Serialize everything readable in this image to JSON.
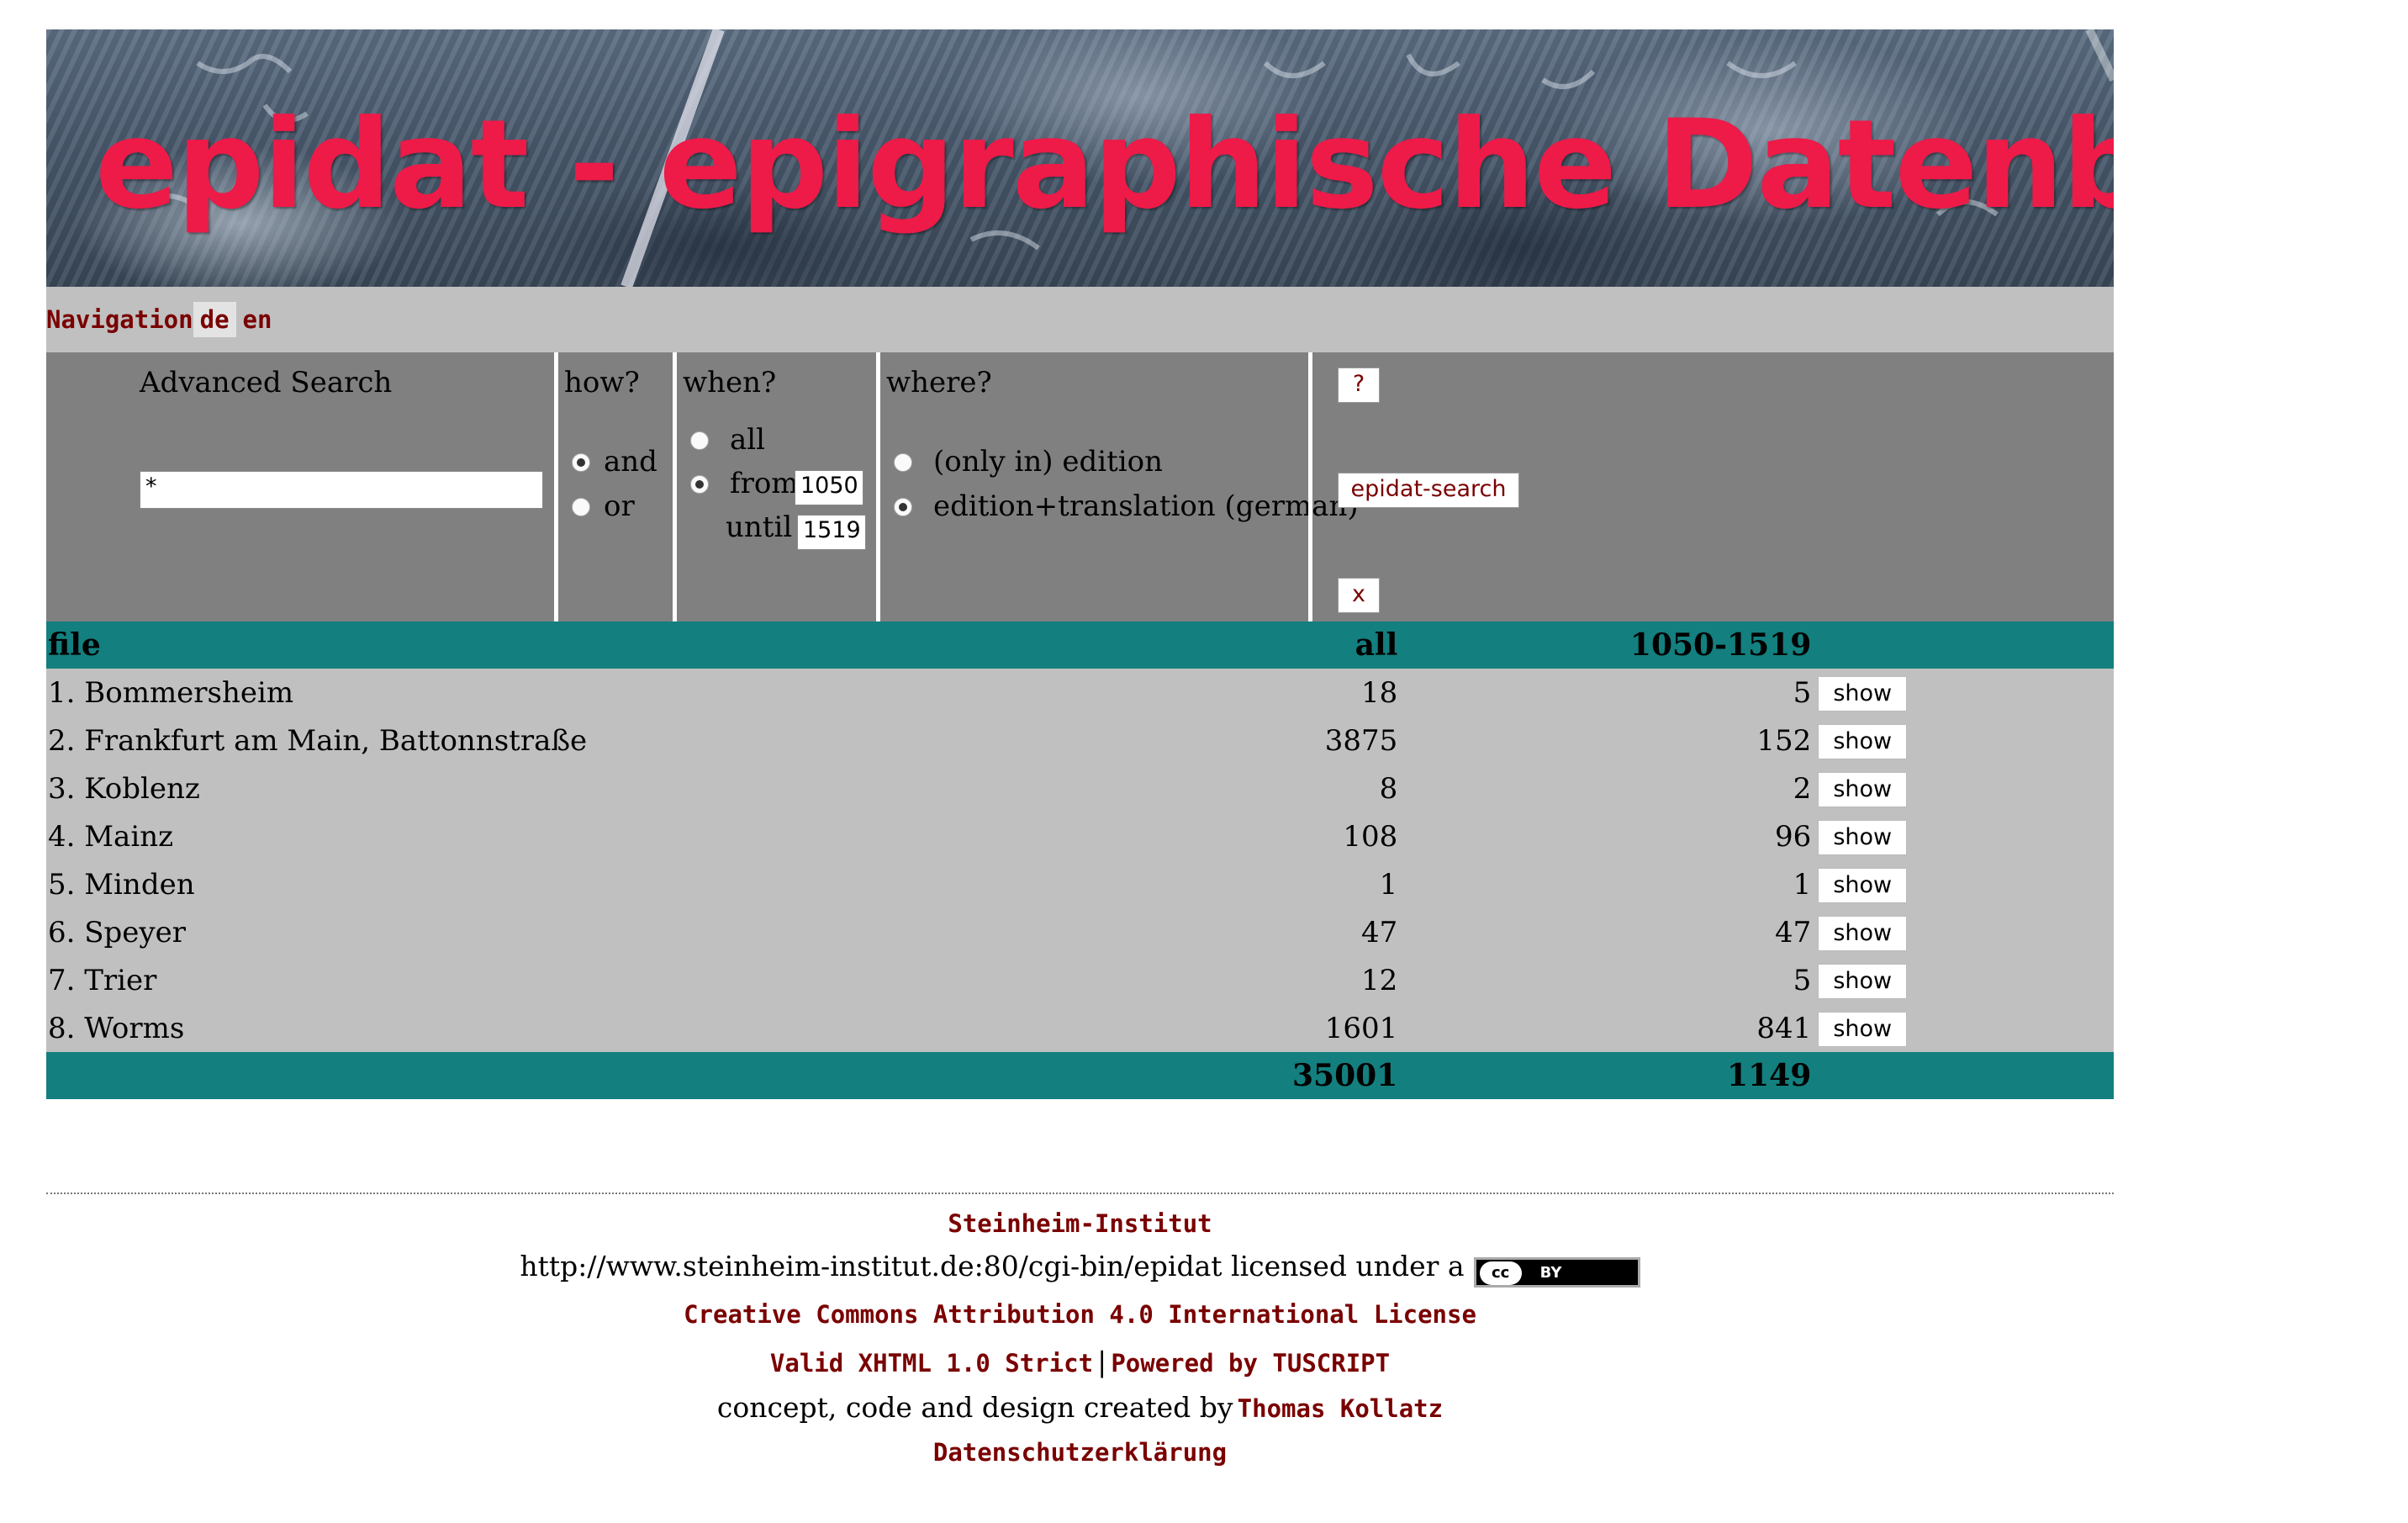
{
  "banner": {
    "title": "epidat - epigraphische Datenbank"
  },
  "nav": {
    "label": "Navigation",
    "langs": [
      "de",
      "en"
    ]
  },
  "search": {
    "title": "Advanced Search",
    "query_value": "*",
    "how": {
      "label": "how?",
      "options": [
        "and",
        "or"
      ],
      "selected": "and"
    },
    "when": {
      "label": "when?",
      "all_label": "all",
      "from_label": "from",
      "from_value": "1050",
      "until_label": "until",
      "until_value": "1519",
      "selected": "from"
    },
    "where": {
      "label": "where?",
      "options": [
        "(only in) edition",
        "edition+translation (german)"
      ],
      "selected": "edition+translation (german)"
    },
    "help_label": "?",
    "submit_label": "epidat-search",
    "clear_label": "x"
  },
  "results": {
    "headers": {
      "file": "file",
      "all": "all",
      "range": "1050-1519"
    },
    "rows": [
      {
        "name": "1. Bommersheim",
        "all": "18",
        "range": "5",
        "action": "show"
      },
      {
        "name": "2. Frankfurt am Main, Battonnstraße",
        "all": "3875",
        "range": "152",
        "action": "show"
      },
      {
        "name": "3. Koblenz",
        "all": "8",
        "range": "2",
        "action": "show"
      },
      {
        "name": "4. Mainz",
        "all": "108",
        "range": "96",
        "action": "show"
      },
      {
        "name": "5. Minden",
        "all": "1",
        "range": "1",
        "action": "show"
      },
      {
        "name": "6. Speyer",
        "all": "47",
        "range": "47",
        "action": "show"
      },
      {
        "name": "7. Trier",
        "all": "12",
        "range": "5",
        "action": "show"
      },
      {
        "name": "8. Worms",
        "all": "1601",
        "range": "841",
        "action": "show"
      }
    ],
    "totals": {
      "all": "35001",
      "range": "1149"
    }
  },
  "footer": {
    "institute": "Steinheim-Institut",
    "license_text": "http://www.steinheim-institut.de:80/cgi-bin/epidat licensed under a",
    "cc_badge": {
      "left": "cc",
      "right": "BY"
    },
    "license_link": "Creative Commons Attribution 4.0 International License",
    "valid_link": "Valid XHTML 1.0 Strict",
    "sep": "|",
    "powered_link": "Powered by TUSCRIPT",
    "credit_text": "concept, code and design created by",
    "author_link": "Thomas Kollatz",
    "privacy_link": "Datenschutzerklärung"
  }
}
